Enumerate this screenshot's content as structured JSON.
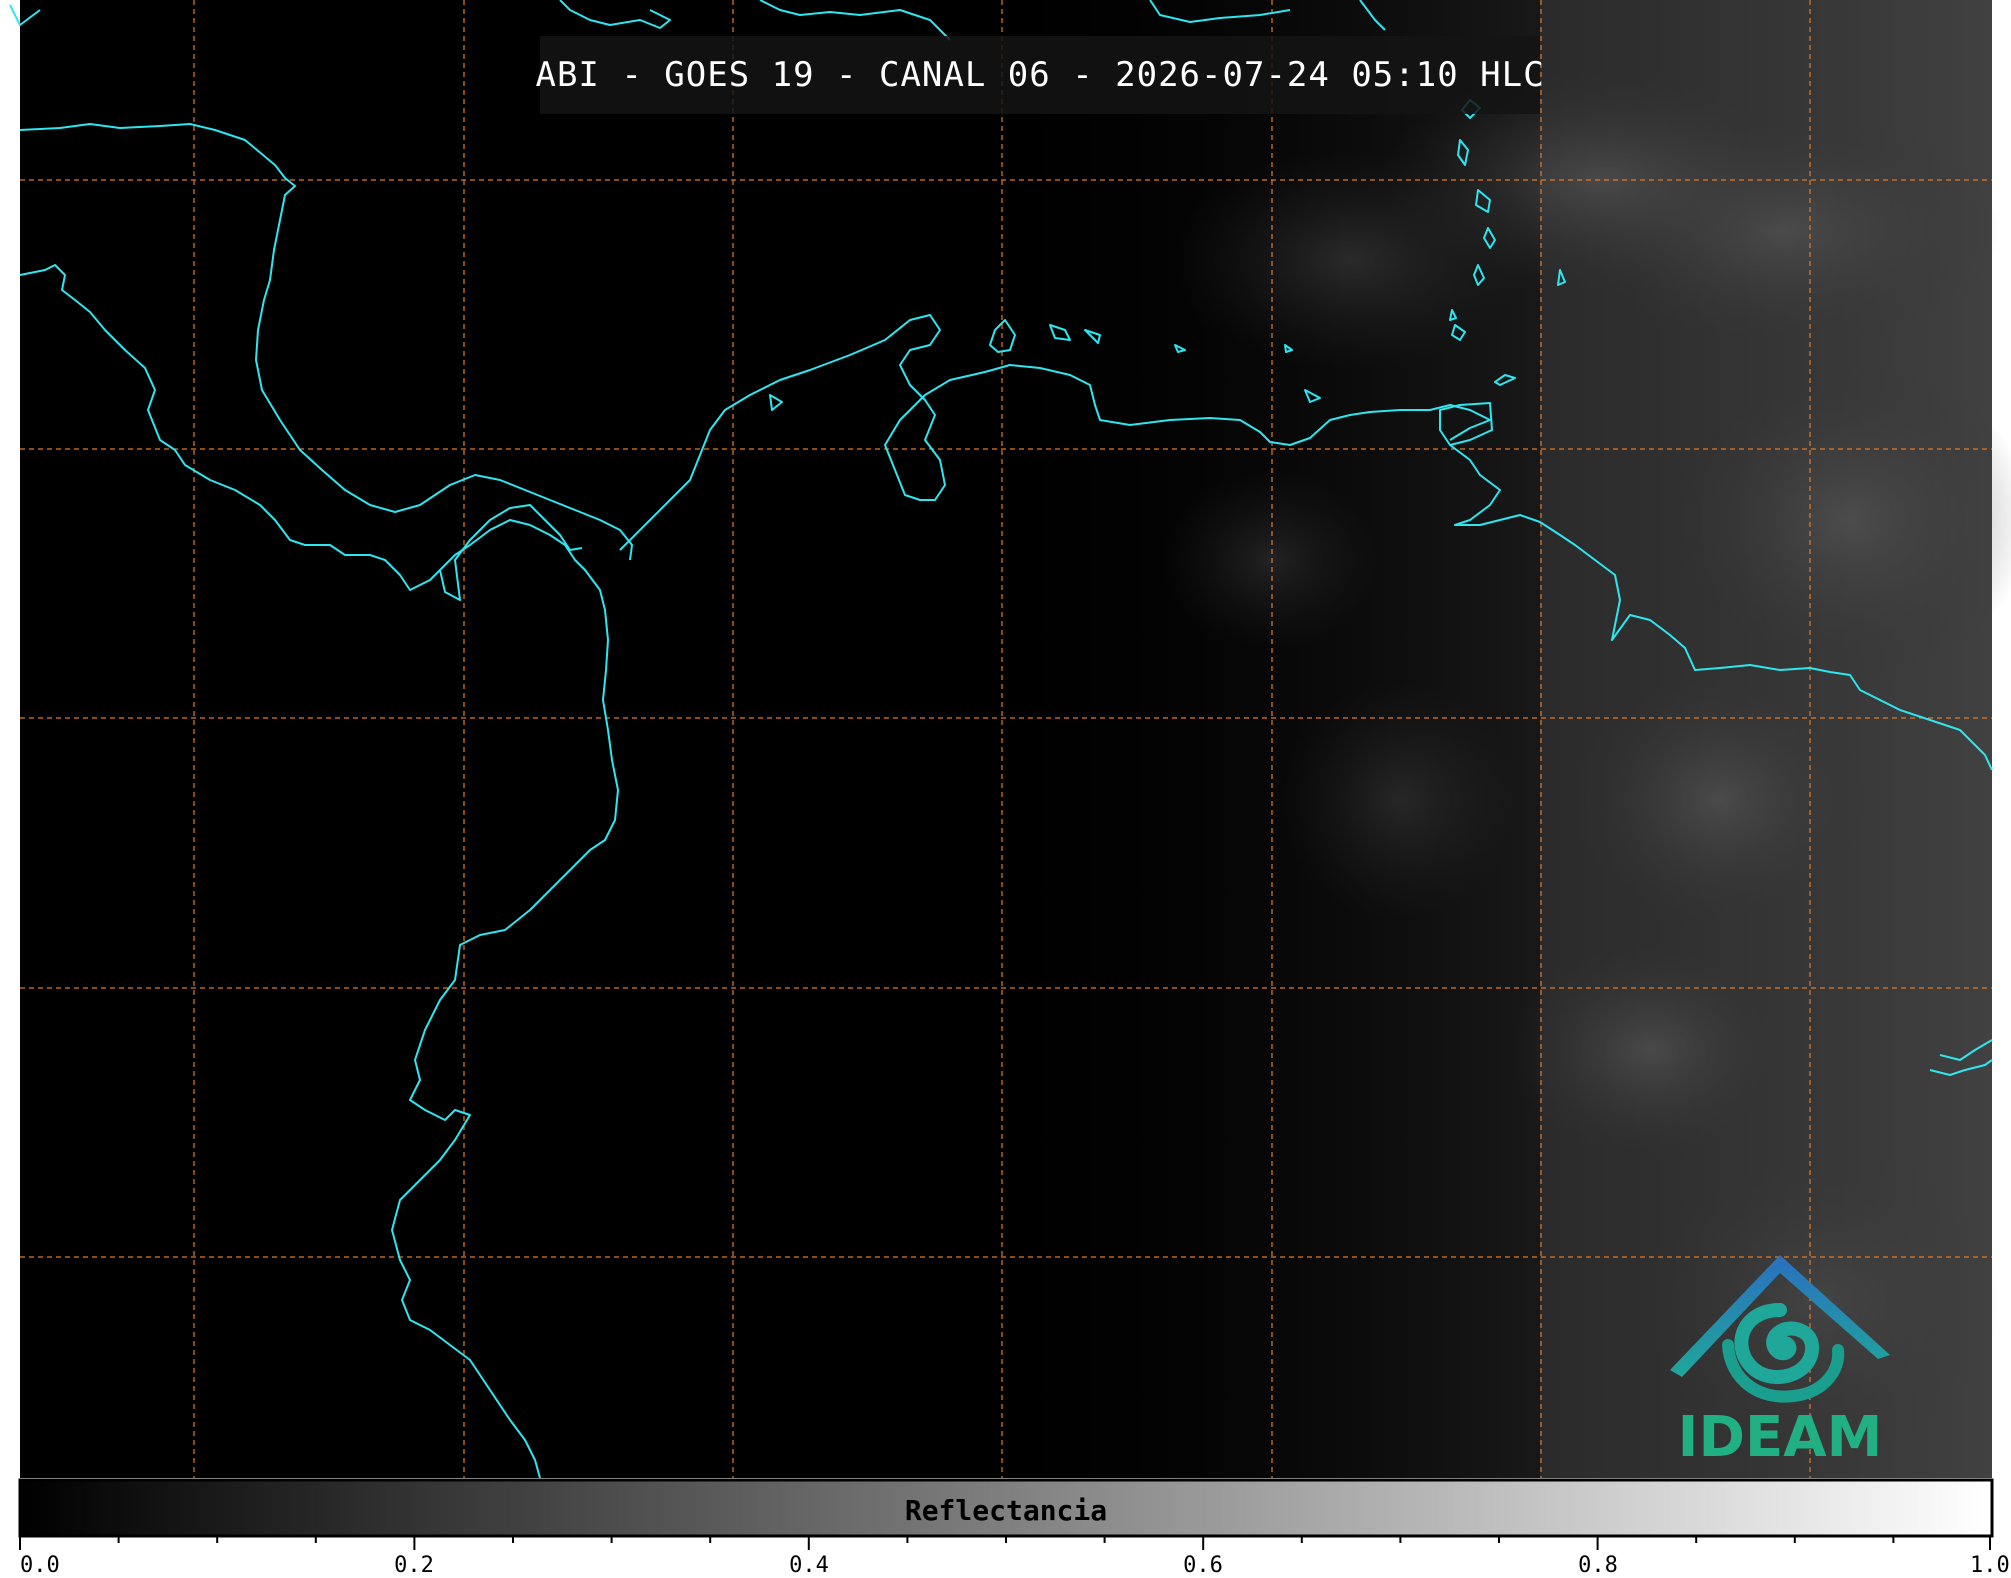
{
  "title": "ABI - GOES 19 - CANAL 06 - 2026-07-24 05:10 HLC",
  "colorbar": {
    "label": "Reflectancia",
    "ticks": [
      "0.0",
      "0.2",
      "0.4",
      "0.6",
      "0.8",
      "1.0"
    ],
    "range": [
      0.0,
      1.0
    ],
    "colormap_start": "#000000",
    "colormap_end": "#ffffff"
  },
  "map": {
    "background": "#000000",
    "coastline_color": "#2ee6f0",
    "gridline_color": "#e07a2a",
    "gridline_style": "dashed"
  },
  "logo": {
    "text": "IDEAM",
    "text_color": "#20b083",
    "roof_color": "#2a6fc0",
    "swirl_color": "#1fa79a"
  }
}
